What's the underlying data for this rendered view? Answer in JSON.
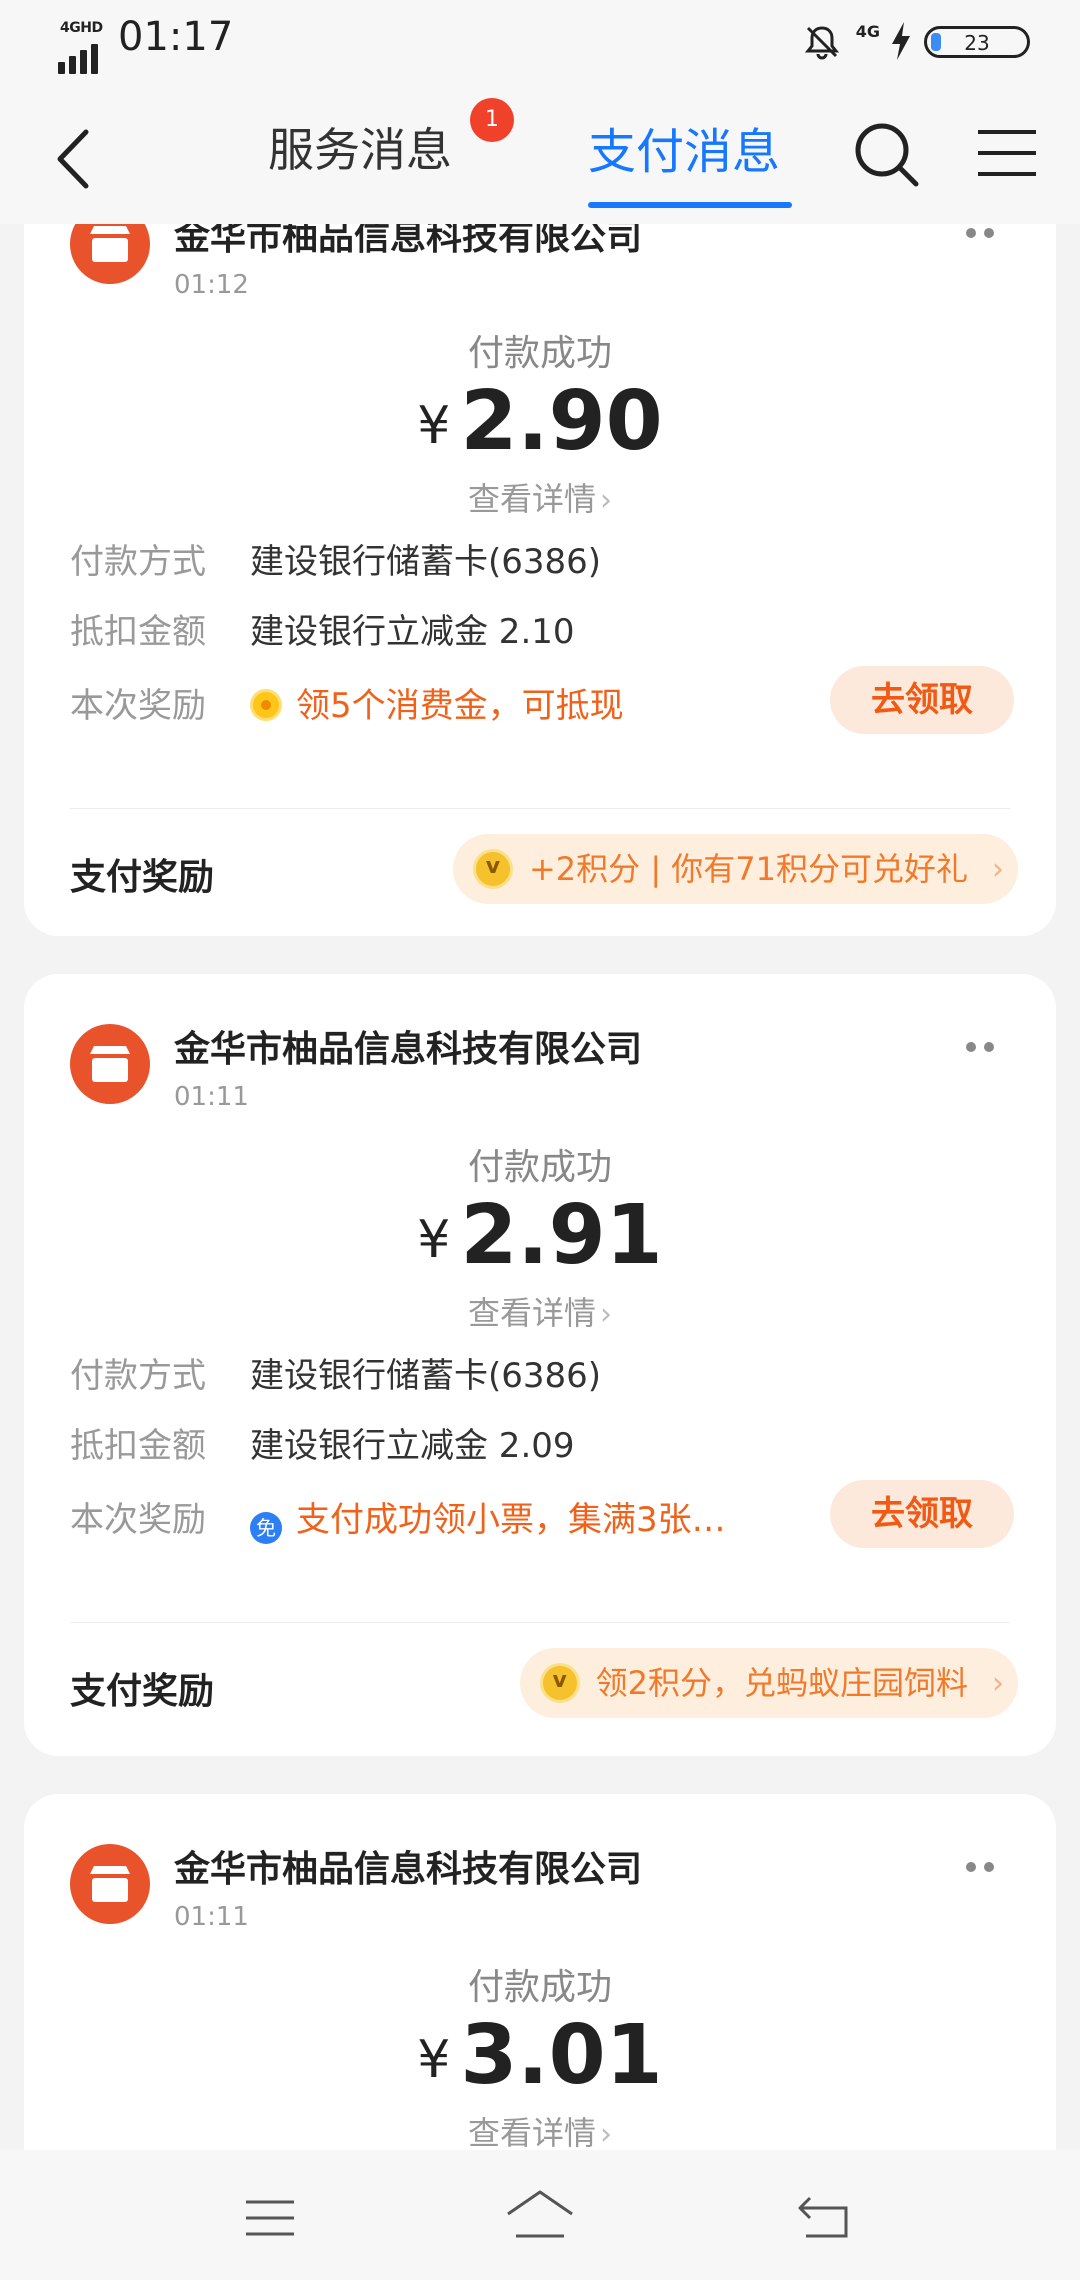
{
  "status_bar": {
    "network": "4GHD",
    "time": "01:17",
    "net_right": "4G",
    "battery": "23"
  },
  "nav": {
    "tab_service": "服务消息",
    "tab_service_badge": "1",
    "tab_pay": "支付消息",
    "active_color": "#1677ff"
  },
  "cards": [
    {
      "merchant": "金华市柚品信息科技有限公司",
      "time": "01:12",
      "status": "付款成功",
      "currency": "¥",
      "amount": "2.90",
      "detail": "查看详情",
      "method_label": "付款方式",
      "method_value": "建设银行储蓄卡(6386)",
      "deduct_label": "抵扣金额",
      "deduct_value": "建设银行立减金 2.10",
      "reward_label": "本次奖励",
      "reward_icon": "coin-icon",
      "reward_value": "领5个消费金，可抵现",
      "claim": "去领取",
      "pay_reward_label": "支付奖励",
      "pay_reward_text": "+2积分 | 你有71积分可兑好礼"
    },
    {
      "merchant": "金华市柚品信息科技有限公司",
      "time": "01:11",
      "status": "付款成功",
      "currency": "¥",
      "amount": "2.91",
      "detail": "查看详情",
      "method_label": "付款方式",
      "method_value": "建设银行储蓄卡(6386)",
      "deduct_label": "抵扣金额",
      "deduct_value": "建设银行立减金 2.09",
      "reward_label": "本次奖励",
      "reward_icon": "free-icon",
      "reward_icon_text": "免",
      "reward_value": "支付成功领小票，集满3张…",
      "claim": "去领取",
      "pay_reward_label": "支付奖励",
      "pay_reward_text": "领2积分，兑蚂蚁庄园饲料"
    },
    {
      "merchant": "金华市柚品信息科技有限公司",
      "time": "01:11",
      "status": "付款成功",
      "currency": "¥",
      "amount": "3.01",
      "detail": "查看详情"
    }
  ],
  "colors": {
    "accent": "#1677ff",
    "logo": "#e8532b",
    "reward_orange": "#f0621a",
    "badge_red": "#f0422b"
  }
}
